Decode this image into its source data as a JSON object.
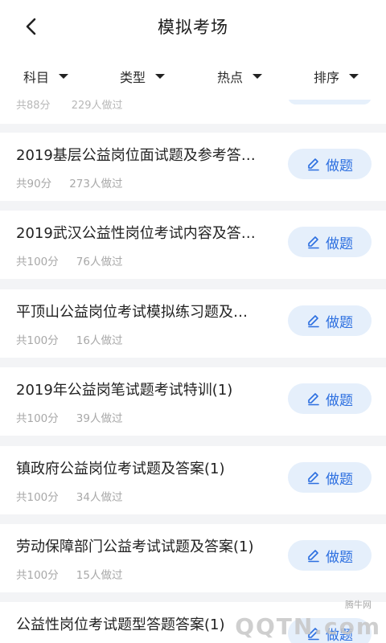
{
  "header": {
    "title": "模拟考场",
    "back_icon": "chevron-left-icon"
  },
  "filters": [
    {
      "label": "科目"
    },
    {
      "label": "类型"
    },
    {
      "label": "热点"
    },
    {
      "label": "排序"
    }
  ],
  "partial_item": {
    "score": "共88分",
    "count": "229人做过"
  },
  "items": [
    {
      "title": "2019基层公益岗位面试题及参考答…",
      "score": "共90分",
      "count": "273人做过",
      "button": "做题"
    },
    {
      "title": "2019武汉公益性岗位考试内容及答…",
      "score": "共100分",
      "count": "76人做过",
      "button": "做题"
    },
    {
      "title": "平顶山公益岗位考试模拟练习题及…",
      "score": "共100分",
      "count": "16人做过",
      "button": "做题"
    },
    {
      "title": "2019年公益岗笔试题考试特训(1)",
      "score": "共100分",
      "count": "39人做过",
      "button": "做题"
    },
    {
      "title": "镇政府公益岗位考试题及答案(1)",
      "score": "共100分",
      "count": "34人做过",
      "button": "做题"
    },
    {
      "title": "劳动保障部门公益考试试题及答案(1)",
      "score": "共100分",
      "count": "15人做过",
      "button": "做题"
    },
    {
      "title": "公益性岗位考试题型答题答案(1)",
      "score": "",
      "count": "",
      "button": "做题"
    }
  ],
  "watermark": {
    "small": "腾牛网",
    "big": "QQTN.com"
  },
  "colors": {
    "accent": "#2c6fe0",
    "button_bg": "#e5effb",
    "page_bg": "#f3f4f6"
  }
}
